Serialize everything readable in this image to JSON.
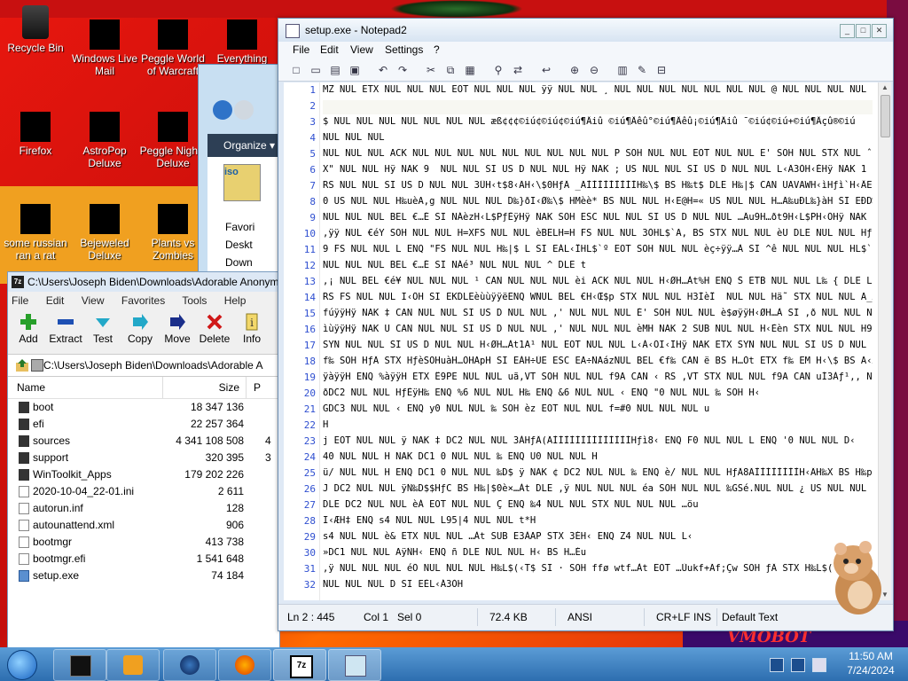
{
  "desktop": {
    "icons": [
      {
        "label": "Recycle Bin"
      },
      {
        "label": "Windows Live Mail"
      },
      {
        "label": "Peggle World of Warcraft"
      },
      {
        "label": "Everything"
      },
      {
        "label": "Firefox"
      },
      {
        "label": "AstroPop Deluxe"
      },
      {
        "label": "Peggle Nights Deluxe"
      },
      {
        "label": "some russian ran a rat"
      },
      {
        "label": "Bejeweled Deluxe"
      },
      {
        "label": "Plants vs Zombies"
      }
    ],
    "watermark": "VMOBOT"
  },
  "explorer": {
    "organize_label": "Organize ▾",
    "iso_label": "iso",
    "items": [
      "Favori",
      "Deskt",
      "Down"
    ]
  },
  "sevenzip": {
    "title": "C:\\Users\\Joseph Biden\\Downloads\\Adorable Anonym",
    "menu": [
      "File",
      "Edit",
      "View",
      "Favorites",
      "Tools",
      "Help"
    ],
    "toolbar": [
      "Add",
      "Extract",
      "Test",
      "Copy",
      "Move",
      "Delete",
      "Info"
    ],
    "path": "C:\\Users\\Joseph Biden\\Downloads\\Adorable A",
    "columns": {
      "name": "Name",
      "size": "Size",
      "packed": "P"
    },
    "files": [
      {
        "name": "boot",
        "size": "18 347 136",
        "type": "folder"
      },
      {
        "name": "efi",
        "size": "22 257 364",
        "type": "folder"
      },
      {
        "name": "sources",
        "size": "4 341 108 508",
        "extra": "4 3",
        "type": "folder"
      },
      {
        "name": "support",
        "size": "320 395",
        "type": "folder"
      },
      {
        "name": "WinToolkit_Apps",
        "size": "179 202 226",
        "type": "folder"
      },
      {
        "name": "2020-10-04_22-01.ini",
        "size": "2 611",
        "type": "file"
      },
      {
        "name": "autorun.inf",
        "size": "128",
        "type": "file"
      },
      {
        "name": "autounattend.xml",
        "size": "906",
        "type": "file"
      },
      {
        "name": "bootmgr",
        "size": "413 738",
        "type": "file"
      },
      {
        "name": "bootmgr.efi",
        "size": "1 541 648",
        "type": "file"
      },
      {
        "name": "setup.exe",
        "size": "74 184",
        "type": "file"
      }
    ]
  },
  "notepad": {
    "title": "setup.exe - Notepad2",
    "menu": [
      "File",
      "Edit",
      "View",
      "Settings",
      "?"
    ],
    "lines": [
      {
        "n": "1",
        "text": "MZ NUL ETX NUL NUL NUL EOT NUL NUL NUL ÿÿ NUL NUL ¸ NUL NUL NUL NUL NUL NUL NUL @ NUL NUL NUL NUL NUL"
      },
      {
        "n": "2",
        "text": ""
      },
      {
        "n": "3",
        "text": "$ NUL NUL NUL NUL NUL NUL NUL æß¢¢¢©iú¢©iú¢©iú¶Âiû ©iú¶Âêû°©iú¶Âêû¡©iú¶Âiû ¯©iú¢©iú+©iú¶Âçû®©iú"
      },
      {
        "n": "4",
        "text": "NUL NUL NUL"
      },
      {
        "n": "5",
        "text": "NUL NUL NUL ACK NUL NUL NUL NUL NUL NUL NUL NUL NUL P SOH NUL NUL EOT NUL NUL E' SOH NUL STX NUL ˆ NUL NUL E"
      },
      {
        "n": "6",
        "text": "X\" NUL NUL Hÿ NAK 9  NUL NUL SI US D NUL NUL Hÿ NAK ; US NUL NUL SI US D NUL NUL L‹Ã3ÒH‹ÈHÿ NAK 1  NUL NUL SI"
      },
      {
        "n": "7",
        "text": "RS NUL NUL SI US D NUL NUL 3ÛH‹t$8‹ÃH‹\\$0HƒÄ _ÃÌÌÌÌÌÌÌÌÌH‰\\$ BS H‰t$ DLE H‰|$ CAN UAVAWH‹ìHƒì`H‹ÂE"
      },
      {
        "n": "8",
        "text": "0 US NUL NUL H‰uèA,g NUL NUL NUL D‰}ðI‹Ø‰\\$ HMèè* BS NUL NUL H‹E@H=« US NUL NUL H…Ã‰uÐL‰}àH SI EÐD‰}"
      },
      {
        "n": "9",
        "text": "NUL NUL NUL BEL €…É SI NÁèzH‹L$PƒÈÿHÿ NAK SOH ESC NUL NUL SI US D NUL NUL …Äu9H…ðt9H‹L$PH‹ÕHÿ NAK ‡ SUB NUL"
      },
      {
        "n": "10",
        "text": ",ÿÿ NUL €éY SOH NUL NUL H=XFS NUL NUL èBELH=H FS NUL NUL 3ÒHL$`A, BS STX NUL NUL èU DLE NUL NUL HƒÈÿHÿÅ"
      },
      {
        "n": "11",
        "text": "9 FS NUL NUL L ENQ \"FS NUL NUL H‰|$ L SI EÁL‹ÎHL$`º EOT SOH NUL NUL èç÷ÿÿ…À SI ^ê NUL NUL NUL HL$`Hÿ NAK"
      },
      {
        "n": "12",
        "text": "NUL NUL NUL BEL €…É SI NÁé³ NUL NUL NUL ^ DLE t"
      },
      {
        "n": "13",
        "text": ",¡ NUL BEL €é¥ NUL NUL NUL ¹ CAN NUL NUL NUL èi ACK NUL NUL H‹ØH…Àt%H ENQ Š ETB NUL NUL L‰ { DLE L CBS H‰ET"
      },
      {
        "n": "14",
        "text": "RS FS NUL NUL I‹ÖH SI EKDLEèùùÿÿëENQ WNUL BEL €H‹Œ$p STX NUL NUL H3ÌèÎ  NUL NUL Hä˜ STX NUL NUL A_A^"
      },
      {
        "n": "15",
        "text": "fúÿÿHÿ NAK ‡ CAN NUL NUL SI US D NUL NUL ,' NUL NUL NUL É' SOH NUL NUL è$øÿÿH‹ØH…À SI ,ð NUL NUL NUL èïøÿÿ"
      },
      {
        "n": "16",
        "text": "ìùÿÿHÿ NAK U CAN NUL NUL SI US D NUL NUL ,' NUL NUL NUL èMH NAK 2 SUB NUL NUL H‹Èèn STX NUL NUL H9{ DLE I‹Î"
      },
      {
        "n": "17",
        "text": "SYN NUL NUL SI US D NUL NUL H‹ØH…Àt1A¹ NUL EOT NUL NUL L‹À‹ÕI‹ÏHÿ NAK ETX SYN NUL NUL SI US D NUL NUL ‹ø"
      },
      {
        "n": "18",
        "text": "f‰ SOH HƒÄ STX HƒèSOHuàH…ÒHApH SI EÁH÷ÚE ESC EA÷ÑAázNUL BEL €f‰ CAN ë BS H…Òt ETX f‰ EM H‹\\$ BS A‹ÃÃÌÌÌ"
      },
      {
        "n": "19",
        "text": "ÿàÿÿH ENQ %àÿÿH ETX Ê9PE NUL NUL uã,VT SOH NUL NUL f9A CAN ‹ RS ,VT STX NUL NUL f9A CAN uÍ3Àƒ¹,‚ NUL NUL"
      },
      {
        "n": "20",
        "text": "ðDC2 NUL NUL HƒÈÿH‰ ENQ %6 NUL NUL H‰ ENQ &6 NUL NUL ‹ ENQ \"0 NUL NUL ‰ SOH H‹"
      },
      {
        "n": "21",
        "text": "GDC3 NUL NUL ‹ ENQ y0 NUL NUL ‰ SOH èz EOT NUL NUL f=#0 NUL NUL NUL u"
      },
      {
        "n": "22",
        "text": "H"
      },
      {
        "n": "23",
        "text": "j EOT NUL NUL ÿ NAK ‡ DC2 NUL NUL 3ÀHƒÄ(ÃÌÌÌÌÌÌÌÌÌÌÌÌÌÌHƒì8‹ ENQ F0 NUL NUL L ENQ '0 NUL NUL D‹"
      },
      {
        "n": "24",
        "text": "40 NUL NUL H NAK DC1 0 NUL NUL ‰ ENQ U0 NUL NUL H"
      },
      {
        "n": "25",
        "text": "ü/ NUL NUL H ENQ DC1 0 NUL NUL ‰D$ ÿ NAK ¢ DC2 NUL NUL ‰ ENQ è/ NUL NUL HƒÄ8ÃÌÌÌÌÌÌÌÌH‹ÄH‰X BS H‰p DLE H‰x"
      },
      {
        "n": "26",
        "text": "J DC2 NUL NUL ÿÑ‰D$$HƒC BS H‰|$0è×…Àt DLE ,ÿ NUL NUL NUL éa SOH NUL NUL ‰GSé.NUL NUL ¿ US NUL NUL NUL ‹"
      },
      {
        "n": "27",
        "text": "DLE DC2 NUL NUL èÁ EOT NUL NUL Ç ENQ ‰4 NUL NUL STX NUL NUL NUL …öu"
      },
      {
        "n": "28",
        "text": "I‹ÆH‡ ENQ s4 NUL NUL L95|4 NUL NUL t*H"
      },
      {
        "n": "29",
        "text": "s4 NUL NUL è& ETX NUL NUL …Àt SUB E3ÀAP STX 3ÉH‹ ENQ Z4 NUL NUL L‹"
      },
      {
        "n": "30",
        "text": "»DC1 NUL NUL AÿÑH‹ ENQ ñ DLE NUL NUL H‹ BS H…Éu"
      },
      {
        "n": "31",
        "text": ",ÿ NUL NUL NUL éÕ NUL NUL NUL H‰L$(‹T$ SI · SOH ffø wtf…Àt EOT …Ùukf+Ãf;Çw SOH ƒÄ STX H‰L$( SI"
      },
      {
        "n": "32",
        "text": "NUL NUL NUL D SI EÈL‹Á3ÒH"
      }
    ],
    "status": {
      "position": "Ln 2 : 445",
      "col": "Col 1",
      "sel": "Sel 0",
      "size": "72.4 KB",
      "encoding": "ANSI",
      "eol": "CR+LF",
      "mode": "INS",
      "scheme": "Default Text"
    }
  },
  "taskbar": {
    "time": "11:50 AM",
    "date": "7/24/2024",
    "items": [
      "explorer",
      "media-player",
      "earth",
      "firefox",
      "7zip",
      "notepad2"
    ]
  }
}
